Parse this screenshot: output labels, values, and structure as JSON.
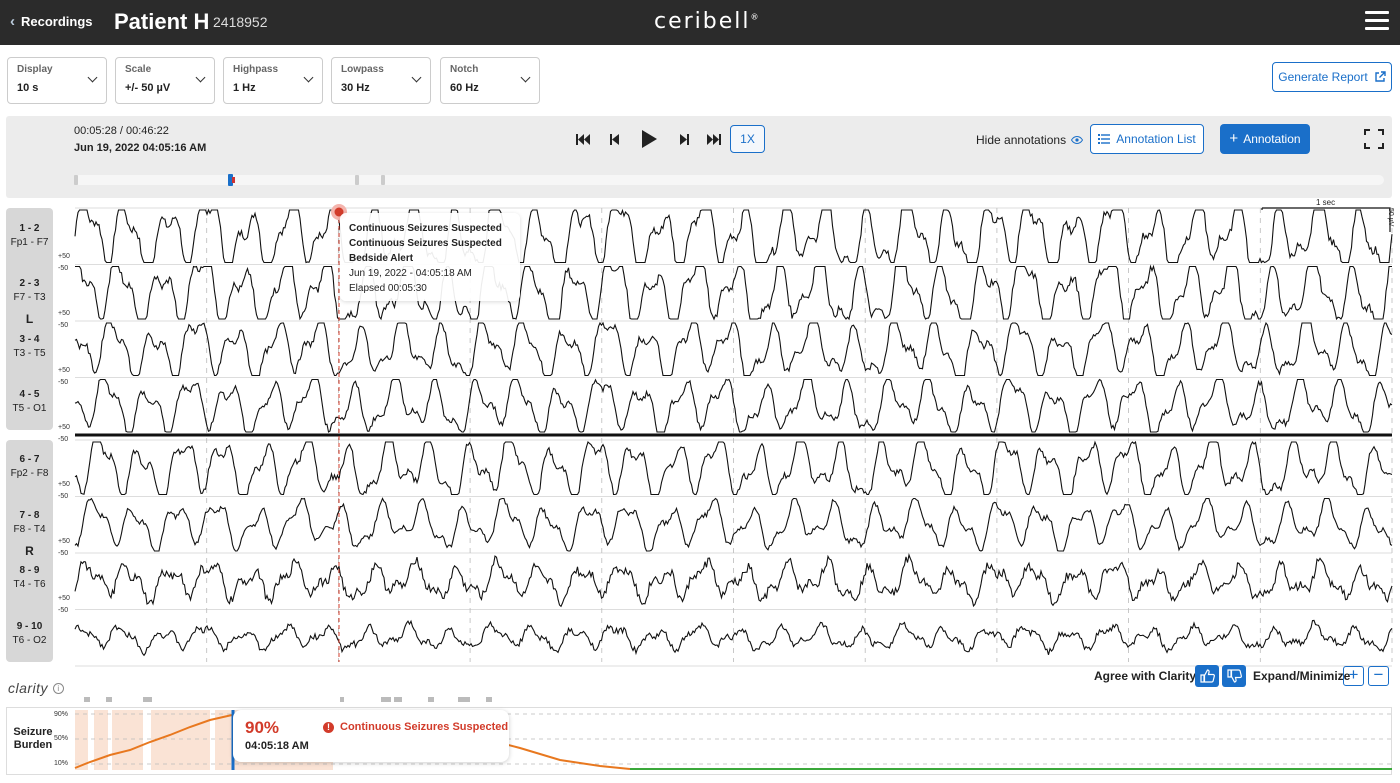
{
  "header": {
    "back_label": "Recordings",
    "patient_name": "Patient H",
    "patient_id": "2418952",
    "logo": "ceribell",
    "logo_mark": "®"
  },
  "controls": [
    {
      "label": "Display",
      "value": "10 s"
    },
    {
      "label": "Scale",
      "value": "+/- 50 µV"
    },
    {
      "label": "Highpass",
      "value": "1 Hz"
    },
    {
      "label": "Lowpass",
      "value": "30 Hz"
    },
    {
      "label": "Notch",
      "value": "60 Hz"
    }
  ],
  "generate_report_label": "Generate Report",
  "playback": {
    "time_position": "00:05:28 / 00:46:22",
    "date_time": "Jun 19, 2022 04:05:16 AM",
    "speed": "1X",
    "hide_annotations_label": "Hide annotations",
    "annotation_list_label": "Annotation List",
    "add_annotation_label": "Annotation",
    "progress_fraction": 0.118
  },
  "channels": {
    "left_hemisphere": "L",
    "right_hemisphere": "R",
    "items": [
      {
        "num": "1 - 2",
        "name": "Fp1 - F7"
      },
      {
        "num": "2 - 3",
        "name": "F7 - T3"
      },
      {
        "num": "3 - 4",
        "name": "T3 - T5"
      },
      {
        "num": "4 - 5",
        "name": "T5 - O1"
      },
      {
        "num": "6 - 7",
        "name": "Fp2 - F8"
      },
      {
        "num": "7 - 8",
        "name": "F8 - T4"
      },
      {
        "num": "8 - 9",
        "name": "T4 - T6"
      },
      {
        "num": "9 - 10",
        "name": "T6 - O2"
      }
    ],
    "scale_plus": "+50",
    "scale_minus": "-50"
  },
  "tooltip": {
    "line1": "Continuous Seizures Suspected",
    "line2": "Continuous Seizures Suspected",
    "line3": "Bedside Alert",
    "line4": "Jun 19, 2022 - 04:05:18 AM",
    "line5": "Elapsed 00:05:30"
  },
  "calibration": {
    "time_label": "1 sec",
    "amplitude_label": "50 µV"
  },
  "clarity": {
    "logo": "clarity",
    "agree_label": "Agree with Clarity?",
    "expand_label": "Expand/Minimize"
  },
  "burden": {
    "title_line1": "Seizure",
    "title_line2": "Burden",
    "axis_90": "90%",
    "axis_50": "50%",
    "axis_10": "10%",
    "value": "90%",
    "time": "04:05:18 AM",
    "alert": "Continuous Seizures Suspected"
  },
  "colors": {
    "accent": "#1a6fc9",
    "alert": "#d23b2a",
    "burden_line": "#e8781f",
    "burden_low": "#3aa83a",
    "header_bg": "#2b2b2b"
  }
}
